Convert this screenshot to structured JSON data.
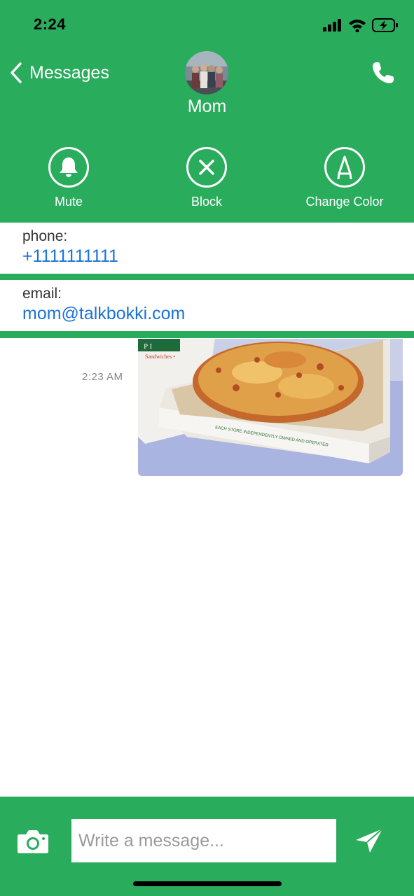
{
  "status_bar": {
    "time": "2:24"
  },
  "header": {
    "back_label": "Messages",
    "contact_name": "Mom",
    "actions": [
      {
        "label": "Mute",
        "icon": "bell-icon"
      },
      {
        "label": "Block",
        "icon": "block-icon"
      },
      {
        "label": "Change Color",
        "icon": "pen-icon"
      }
    ]
  },
  "contact_info": {
    "phone_label": "phone:",
    "phone_value": "+1111111111",
    "email_label": "email:",
    "email_value": "mom@talkbokki.com"
  },
  "messages": [
    {
      "time": "2:23 AM",
      "type": "image"
    }
  ],
  "composer": {
    "placeholder": "Write a message..."
  },
  "colors": {
    "accent": "#2aac5d",
    "link": "#1a73d9"
  }
}
